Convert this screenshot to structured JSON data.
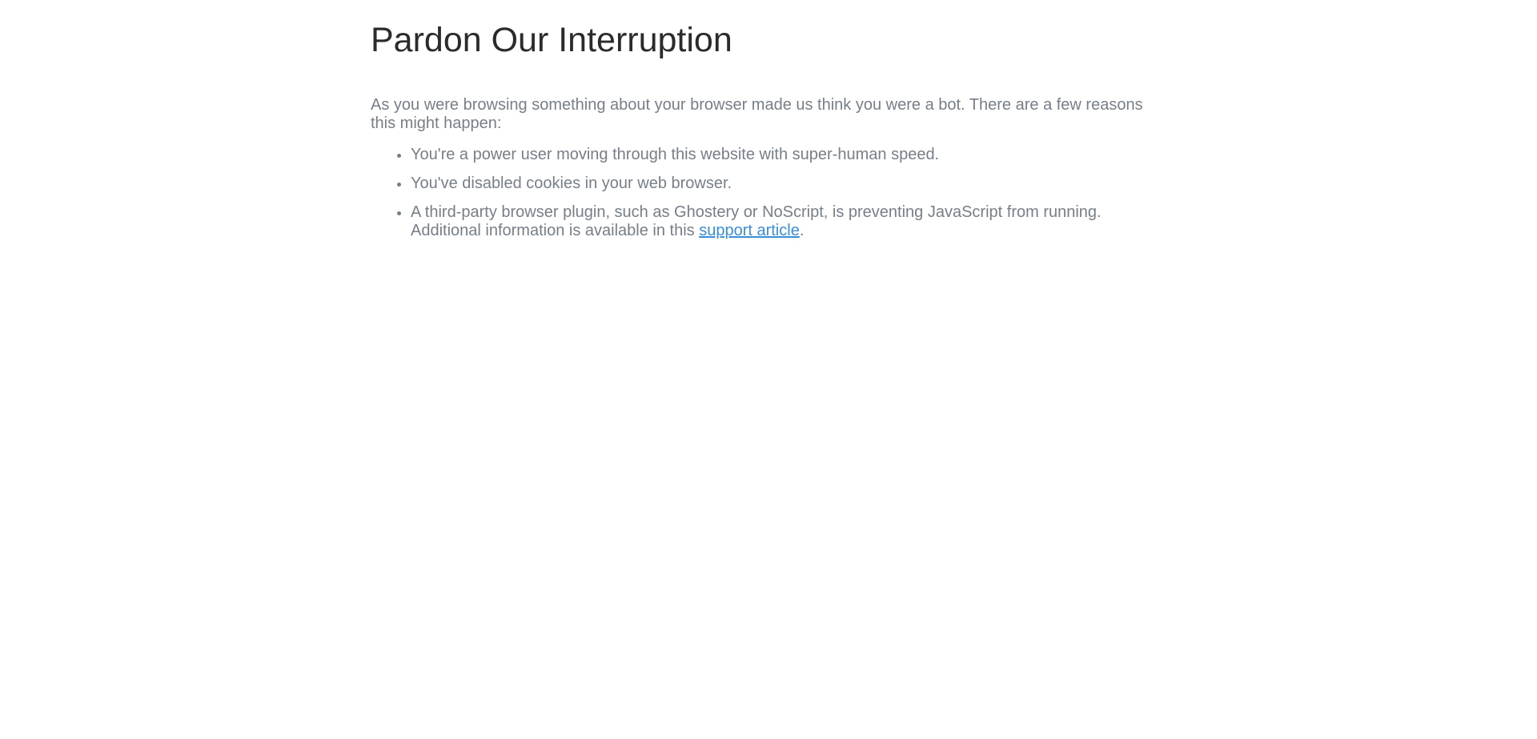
{
  "page": {
    "title": "Pardon Our Interruption",
    "intro_line1": "As you were browsing something about your browser made us think you were a bot. There are a few reasons",
    "intro_line2": "this might happen:",
    "reasons": [
      "You're a power user moving through this website with super-human speed.",
      "You've disabled cookies in your web browser."
    ],
    "plugin_reason_line1": "A third-party browser plugin, such as Ghostery or NoScript, is preventing JavaScript from running.",
    "plugin_reason_line2_prefix": "Additional information is available in this ",
    "support_link_label": "support article",
    "plugin_reason_suffix": "."
  },
  "colors": {
    "heading": "#2b2b2b",
    "body_text": "#767f88",
    "link": "#3a8ed8",
    "background": "#ffffff"
  }
}
